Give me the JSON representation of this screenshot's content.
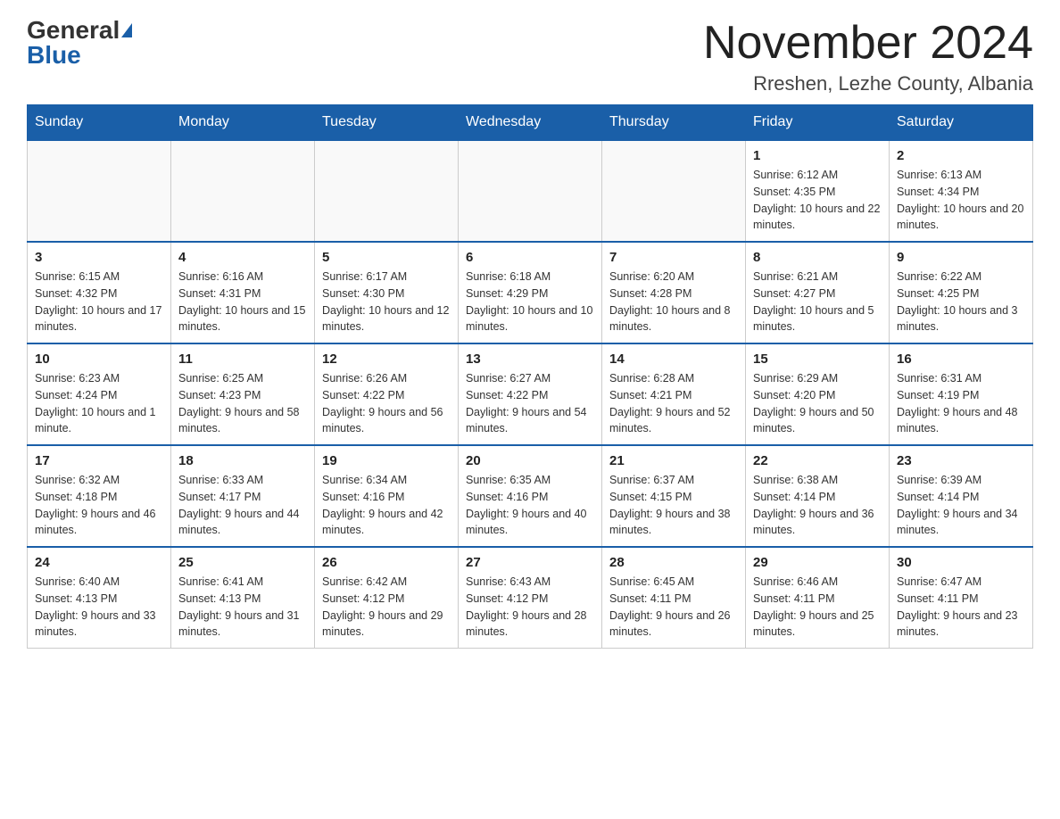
{
  "header": {
    "logo_general": "General",
    "logo_blue": "Blue",
    "month_title": "November 2024",
    "location": "Rreshen, Lezhe County, Albania"
  },
  "weekdays": [
    "Sunday",
    "Monday",
    "Tuesday",
    "Wednesday",
    "Thursday",
    "Friday",
    "Saturday"
  ],
  "weeks": [
    [
      {
        "day": "",
        "info": ""
      },
      {
        "day": "",
        "info": ""
      },
      {
        "day": "",
        "info": ""
      },
      {
        "day": "",
        "info": ""
      },
      {
        "day": "",
        "info": ""
      },
      {
        "day": "1",
        "info": "Sunrise: 6:12 AM\nSunset: 4:35 PM\nDaylight: 10 hours and 22 minutes."
      },
      {
        "day": "2",
        "info": "Sunrise: 6:13 AM\nSunset: 4:34 PM\nDaylight: 10 hours and 20 minutes."
      }
    ],
    [
      {
        "day": "3",
        "info": "Sunrise: 6:15 AM\nSunset: 4:32 PM\nDaylight: 10 hours and 17 minutes."
      },
      {
        "day": "4",
        "info": "Sunrise: 6:16 AM\nSunset: 4:31 PM\nDaylight: 10 hours and 15 minutes."
      },
      {
        "day": "5",
        "info": "Sunrise: 6:17 AM\nSunset: 4:30 PM\nDaylight: 10 hours and 12 minutes."
      },
      {
        "day": "6",
        "info": "Sunrise: 6:18 AM\nSunset: 4:29 PM\nDaylight: 10 hours and 10 minutes."
      },
      {
        "day": "7",
        "info": "Sunrise: 6:20 AM\nSunset: 4:28 PM\nDaylight: 10 hours and 8 minutes."
      },
      {
        "day": "8",
        "info": "Sunrise: 6:21 AM\nSunset: 4:27 PM\nDaylight: 10 hours and 5 minutes."
      },
      {
        "day": "9",
        "info": "Sunrise: 6:22 AM\nSunset: 4:25 PM\nDaylight: 10 hours and 3 minutes."
      }
    ],
    [
      {
        "day": "10",
        "info": "Sunrise: 6:23 AM\nSunset: 4:24 PM\nDaylight: 10 hours and 1 minute."
      },
      {
        "day": "11",
        "info": "Sunrise: 6:25 AM\nSunset: 4:23 PM\nDaylight: 9 hours and 58 minutes."
      },
      {
        "day": "12",
        "info": "Sunrise: 6:26 AM\nSunset: 4:22 PM\nDaylight: 9 hours and 56 minutes."
      },
      {
        "day": "13",
        "info": "Sunrise: 6:27 AM\nSunset: 4:22 PM\nDaylight: 9 hours and 54 minutes."
      },
      {
        "day": "14",
        "info": "Sunrise: 6:28 AM\nSunset: 4:21 PM\nDaylight: 9 hours and 52 minutes."
      },
      {
        "day": "15",
        "info": "Sunrise: 6:29 AM\nSunset: 4:20 PM\nDaylight: 9 hours and 50 minutes."
      },
      {
        "day": "16",
        "info": "Sunrise: 6:31 AM\nSunset: 4:19 PM\nDaylight: 9 hours and 48 minutes."
      }
    ],
    [
      {
        "day": "17",
        "info": "Sunrise: 6:32 AM\nSunset: 4:18 PM\nDaylight: 9 hours and 46 minutes."
      },
      {
        "day": "18",
        "info": "Sunrise: 6:33 AM\nSunset: 4:17 PM\nDaylight: 9 hours and 44 minutes."
      },
      {
        "day": "19",
        "info": "Sunrise: 6:34 AM\nSunset: 4:16 PM\nDaylight: 9 hours and 42 minutes."
      },
      {
        "day": "20",
        "info": "Sunrise: 6:35 AM\nSunset: 4:16 PM\nDaylight: 9 hours and 40 minutes."
      },
      {
        "day": "21",
        "info": "Sunrise: 6:37 AM\nSunset: 4:15 PM\nDaylight: 9 hours and 38 minutes."
      },
      {
        "day": "22",
        "info": "Sunrise: 6:38 AM\nSunset: 4:14 PM\nDaylight: 9 hours and 36 minutes."
      },
      {
        "day": "23",
        "info": "Sunrise: 6:39 AM\nSunset: 4:14 PM\nDaylight: 9 hours and 34 minutes."
      }
    ],
    [
      {
        "day": "24",
        "info": "Sunrise: 6:40 AM\nSunset: 4:13 PM\nDaylight: 9 hours and 33 minutes."
      },
      {
        "day": "25",
        "info": "Sunrise: 6:41 AM\nSunset: 4:13 PM\nDaylight: 9 hours and 31 minutes."
      },
      {
        "day": "26",
        "info": "Sunrise: 6:42 AM\nSunset: 4:12 PM\nDaylight: 9 hours and 29 minutes."
      },
      {
        "day": "27",
        "info": "Sunrise: 6:43 AM\nSunset: 4:12 PM\nDaylight: 9 hours and 28 minutes."
      },
      {
        "day": "28",
        "info": "Sunrise: 6:45 AM\nSunset: 4:11 PM\nDaylight: 9 hours and 26 minutes."
      },
      {
        "day": "29",
        "info": "Sunrise: 6:46 AM\nSunset: 4:11 PM\nDaylight: 9 hours and 25 minutes."
      },
      {
        "day": "30",
        "info": "Sunrise: 6:47 AM\nSunset: 4:11 PM\nDaylight: 9 hours and 23 minutes."
      }
    ]
  ]
}
